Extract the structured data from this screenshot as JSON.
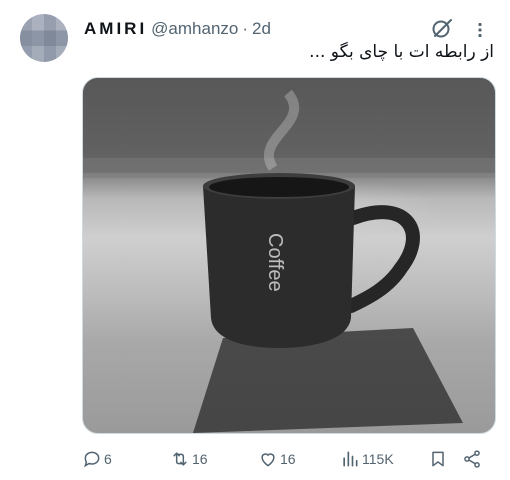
{
  "tweet": {
    "display_name": "AMIRI",
    "handle": "@amhanzo",
    "separator": "·",
    "time": "2d",
    "text": "از رابطه ات با چای بگو ...",
    "mug_text": "Coffee"
  },
  "actions": {
    "replies": "6",
    "retweets": "16",
    "likes": "16",
    "views": "115K"
  },
  "icons": {
    "grok": "grok-icon",
    "more": "more-icon",
    "reply": "reply-icon",
    "retweet": "retweet-icon",
    "like": "heart-icon",
    "views": "views-icon",
    "bookmark": "bookmark-icon",
    "share": "share-icon"
  },
  "colors": {
    "secondary": "#536471",
    "text": "#0f1419"
  }
}
